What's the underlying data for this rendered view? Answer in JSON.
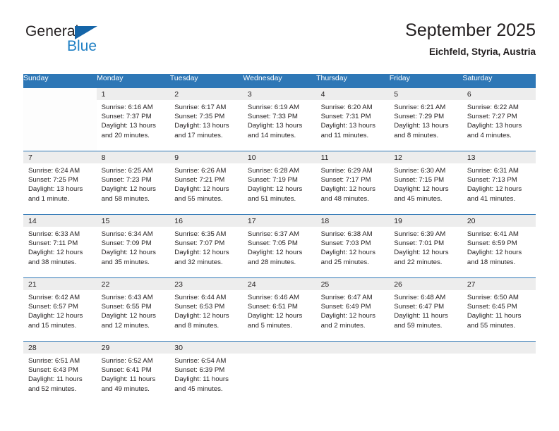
{
  "brand": {
    "word_one": "General",
    "word_two": "Blue",
    "accent_dark": "#1565a8",
    "accent_light": "#1e7fc4",
    "triangle_icon": "triangle-icon"
  },
  "header": {
    "title": "September 2025",
    "location": "Eichfeld, Styria, Austria"
  },
  "calendar": {
    "header_bg": "#2e77b6",
    "daynum_bg": "#ededed",
    "weekdays": [
      "Sunday",
      "Monday",
      "Tuesday",
      "Wednesday",
      "Thursday",
      "Friday",
      "Saturday"
    ],
    "weeks": [
      [
        {
          "day": "",
          "blank": true
        },
        {
          "day": "1",
          "sunrise": "Sunrise: 6:16 AM",
          "sunset": "Sunset: 7:37 PM",
          "daylight1": "Daylight: 13 hours",
          "daylight2": "and 20 minutes."
        },
        {
          "day": "2",
          "sunrise": "Sunrise: 6:17 AM",
          "sunset": "Sunset: 7:35 PM",
          "daylight1": "Daylight: 13 hours",
          "daylight2": "and 17 minutes."
        },
        {
          "day": "3",
          "sunrise": "Sunrise: 6:19 AM",
          "sunset": "Sunset: 7:33 PM",
          "daylight1": "Daylight: 13 hours",
          "daylight2": "and 14 minutes."
        },
        {
          "day": "4",
          "sunrise": "Sunrise: 6:20 AM",
          "sunset": "Sunset: 7:31 PM",
          "daylight1": "Daylight: 13 hours",
          "daylight2": "and 11 minutes."
        },
        {
          "day": "5",
          "sunrise": "Sunrise: 6:21 AM",
          "sunset": "Sunset: 7:29 PM",
          "daylight1": "Daylight: 13 hours",
          "daylight2": "and 8 minutes."
        },
        {
          "day": "6",
          "sunrise": "Sunrise: 6:22 AM",
          "sunset": "Sunset: 7:27 PM",
          "daylight1": "Daylight: 13 hours",
          "daylight2": "and 4 minutes."
        }
      ],
      [
        {
          "day": "7",
          "sunrise": "Sunrise: 6:24 AM",
          "sunset": "Sunset: 7:25 PM",
          "daylight1": "Daylight: 13 hours",
          "daylight2": "and 1 minute."
        },
        {
          "day": "8",
          "sunrise": "Sunrise: 6:25 AM",
          "sunset": "Sunset: 7:23 PM",
          "daylight1": "Daylight: 12 hours",
          "daylight2": "and 58 minutes."
        },
        {
          "day": "9",
          "sunrise": "Sunrise: 6:26 AM",
          "sunset": "Sunset: 7:21 PM",
          "daylight1": "Daylight: 12 hours",
          "daylight2": "and 55 minutes."
        },
        {
          "day": "10",
          "sunrise": "Sunrise: 6:28 AM",
          "sunset": "Sunset: 7:19 PM",
          "daylight1": "Daylight: 12 hours",
          "daylight2": "and 51 minutes."
        },
        {
          "day": "11",
          "sunrise": "Sunrise: 6:29 AM",
          "sunset": "Sunset: 7:17 PM",
          "daylight1": "Daylight: 12 hours",
          "daylight2": "and 48 minutes."
        },
        {
          "day": "12",
          "sunrise": "Sunrise: 6:30 AM",
          "sunset": "Sunset: 7:15 PM",
          "daylight1": "Daylight: 12 hours",
          "daylight2": "and 45 minutes."
        },
        {
          "day": "13",
          "sunrise": "Sunrise: 6:31 AM",
          "sunset": "Sunset: 7:13 PM",
          "daylight1": "Daylight: 12 hours",
          "daylight2": "and 41 minutes."
        }
      ],
      [
        {
          "day": "14",
          "sunrise": "Sunrise: 6:33 AM",
          "sunset": "Sunset: 7:11 PM",
          "daylight1": "Daylight: 12 hours",
          "daylight2": "and 38 minutes."
        },
        {
          "day": "15",
          "sunrise": "Sunrise: 6:34 AM",
          "sunset": "Sunset: 7:09 PM",
          "daylight1": "Daylight: 12 hours",
          "daylight2": "and 35 minutes."
        },
        {
          "day": "16",
          "sunrise": "Sunrise: 6:35 AM",
          "sunset": "Sunset: 7:07 PM",
          "daylight1": "Daylight: 12 hours",
          "daylight2": "and 32 minutes."
        },
        {
          "day": "17",
          "sunrise": "Sunrise: 6:37 AM",
          "sunset": "Sunset: 7:05 PM",
          "daylight1": "Daylight: 12 hours",
          "daylight2": "and 28 minutes."
        },
        {
          "day": "18",
          "sunrise": "Sunrise: 6:38 AM",
          "sunset": "Sunset: 7:03 PM",
          "daylight1": "Daylight: 12 hours",
          "daylight2": "and 25 minutes."
        },
        {
          "day": "19",
          "sunrise": "Sunrise: 6:39 AM",
          "sunset": "Sunset: 7:01 PM",
          "daylight1": "Daylight: 12 hours",
          "daylight2": "and 22 minutes."
        },
        {
          "day": "20",
          "sunrise": "Sunrise: 6:41 AM",
          "sunset": "Sunset: 6:59 PM",
          "daylight1": "Daylight: 12 hours",
          "daylight2": "and 18 minutes."
        }
      ],
      [
        {
          "day": "21",
          "sunrise": "Sunrise: 6:42 AM",
          "sunset": "Sunset: 6:57 PM",
          "daylight1": "Daylight: 12 hours",
          "daylight2": "and 15 minutes."
        },
        {
          "day": "22",
          "sunrise": "Sunrise: 6:43 AM",
          "sunset": "Sunset: 6:55 PM",
          "daylight1": "Daylight: 12 hours",
          "daylight2": "and 12 minutes."
        },
        {
          "day": "23",
          "sunrise": "Sunrise: 6:44 AM",
          "sunset": "Sunset: 6:53 PM",
          "daylight1": "Daylight: 12 hours",
          "daylight2": "and 8 minutes."
        },
        {
          "day": "24",
          "sunrise": "Sunrise: 6:46 AM",
          "sunset": "Sunset: 6:51 PM",
          "daylight1": "Daylight: 12 hours",
          "daylight2": "and 5 minutes."
        },
        {
          "day": "25",
          "sunrise": "Sunrise: 6:47 AM",
          "sunset": "Sunset: 6:49 PM",
          "daylight1": "Daylight: 12 hours",
          "daylight2": "and 2 minutes."
        },
        {
          "day": "26",
          "sunrise": "Sunrise: 6:48 AM",
          "sunset": "Sunset: 6:47 PM",
          "daylight1": "Daylight: 11 hours",
          "daylight2": "and 59 minutes."
        },
        {
          "day": "27",
          "sunrise": "Sunrise: 6:50 AM",
          "sunset": "Sunset: 6:45 PM",
          "daylight1": "Daylight: 11 hours",
          "daylight2": "and 55 minutes."
        }
      ],
      [
        {
          "day": "28",
          "sunrise": "Sunrise: 6:51 AM",
          "sunset": "Sunset: 6:43 PM",
          "daylight1": "Daylight: 11 hours",
          "daylight2": "and 52 minutes."
        },
        {
          "day": "29",
          "sunrise": "Sunrise: 6:52 AM",
          "sunset": "Sunset: 6:41 PM",
          "daylight1": "Daylight: 11 hours",
          "daylight2": "and 49 minutes."
        },
        {
          "day": "30",
          "sunrise": "Sunrise: 6:54 AM",
          "sunset": "Sunset: 6:39 PM",
          "daylight1": "Daylight: 11 hours",
          "daylight2": "and 45 minutes."
        },
        {
          "day": "",
          "empty": true
        },
        {
          "day": "",
          "empty": true
        },
        {
          "day": "",
          "empty": true
        },
        {
          "day": "",
          "empty": true
        }
      ]
    ]
  }
}
